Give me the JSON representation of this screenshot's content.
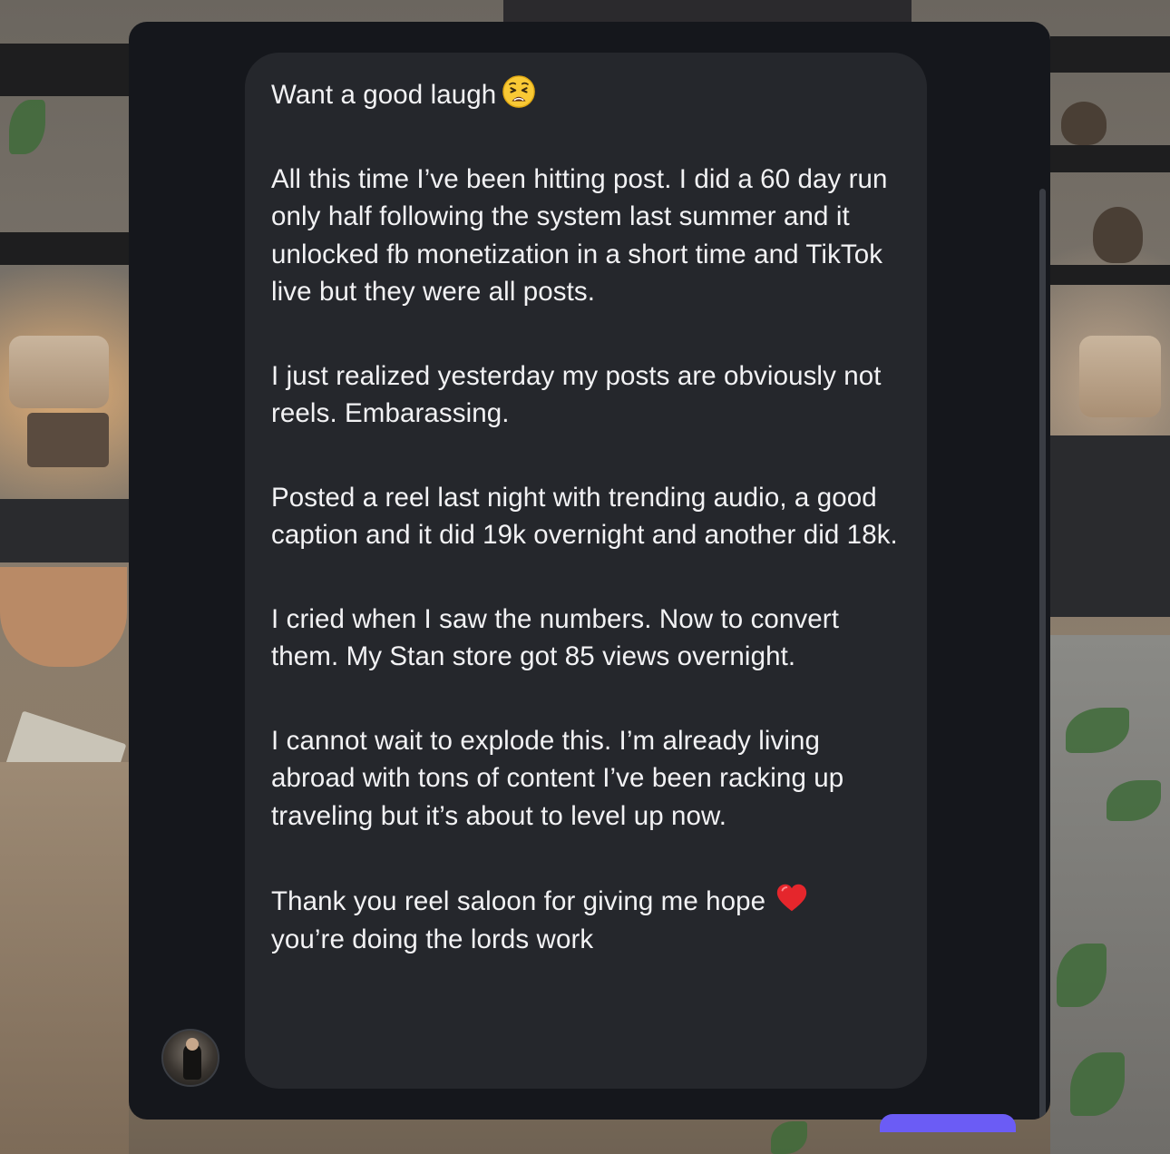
{
  "message": {
    "paragraphs": [
      "Want a good laugh",
      "All this time I’ve been hitting post. I did a 60 day run only half following the system last summer and it unlocked fb monetization in a short time and TikTok live but they were all posts.",
      "I just realized yesterday my posts are obviously not reels. Embarassing.",
      "Posted a reel last night with trending audio, a good caption and it did 19k overnight and another did 18k.",
      "I cried when I saw the numbers. Now to convert them. My Stan store got 85 views overnight.",
      "I cannot wait to explode this. I’m already living abroad with tons of content I’ve been racking up traveling but it’s about to level up now.",
      "Thank you reel saloon for giving me hope",
      "you’re doing the lords work"
    ],
    "icons": {
      "first_line": "weary-face-emoji-icon",
      "thanks_line": "red-heart-emoji-icon"
    }
  },
  "colors": {
    "panel_background": "#15171c",
    "bubble_background": "#25272c",
    "text": "#f2f2f4",
    "accent": "#6b5cf5"
  }
}
